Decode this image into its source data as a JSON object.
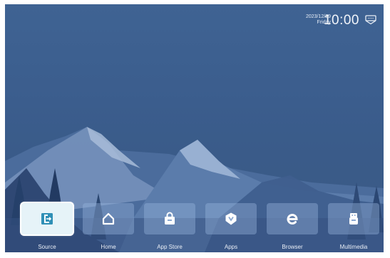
{
  "status_bar": {
    "date": "2023/12/29",
    "day": "Friday",
    "time": "10:00",
    "notification_icon": "inbox-icon"
  },
  "dock": {
    "selected_index": 0,
    "apps": [
      {
        "label": "Source",
        "icon": "source-input-icon"
      },
      {
        "label": "Home",
        "icon": "home-icon"
      },
      {
        "label": "App Store",
        "icon": "shopping-bag-icon"
      },
      {
        "label": "Apps",
        "icon": "shield-apps-icon"
      },
      {
        "label": "Browser",
        "icon": "browser-e-icon"
      },
      {
        "label": "Multimedia",
        "icon": "usb-drive-icon"
      }
    ]
  },
  "colors": {
    "background": "#3b5d8d",
    "tile": "#96b2dc",
    "selected_tile": "#e6f3f8",
    "source_icon": "#2f8fb6"
  }
}
